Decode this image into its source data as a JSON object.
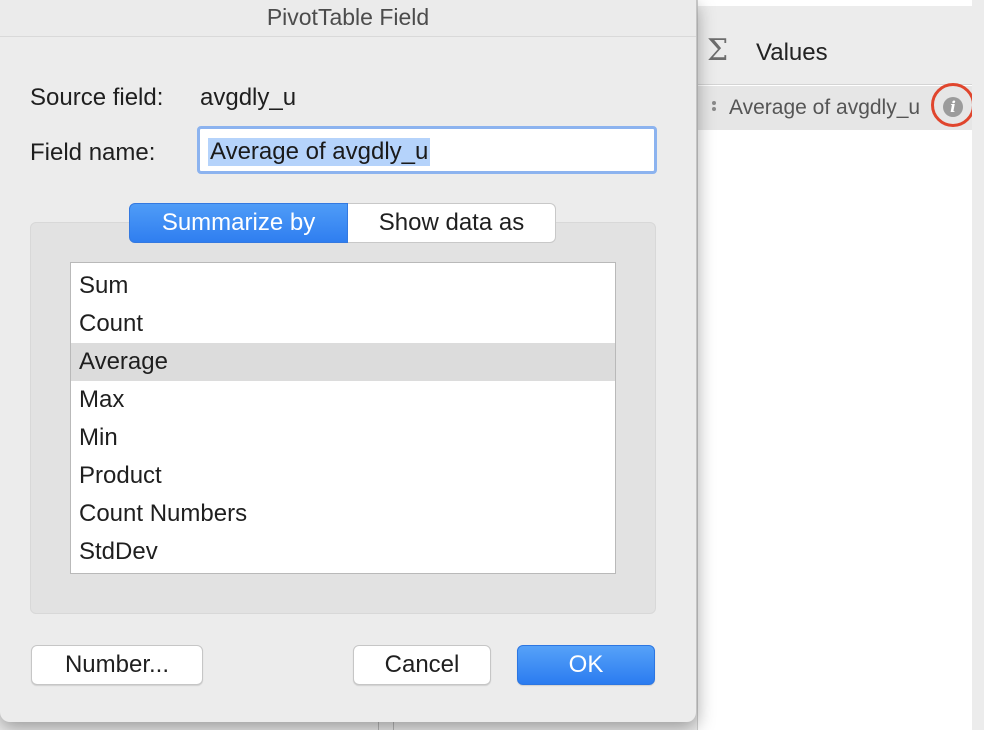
{
  "dialog": {
    "title": "PivotTable Field",
    "source_field_label": "Source field:",
    "source_field_value": "avgdly_u",
    "field_name_label": "Field name:",
    "field_name_value": "Average of avgdly_u",
    "tabs": [
      {
        "label": "Summarize by",
        "selected": true
      },
      {
        "label": "Show data as",
        "selected": false
      }
    ],
    "summarize_options": [
      {
        "label": "Sum"
      },
      {
        "label": "Count"
      },
      {
        "label": "Average",
        "selected": true
      },
      {
        "label": "Max"
      },
      {
        "label": "Min"
      },
      {
        "label": "Product"
      },
      {
        "label": "Count Numbers"
      },
      {
        "label": "StdDev"
      }
    ],
    "buttons": {
      "number": "Number...",
      "cancel": "Cancel",
      "ok": "OK"
    }
  },
  "field_list": {
    "values_header": "Values",
    "values_icon": "sigma-icon",
    "value_items": [
      {
        "label": "Average of avgdly_u"
      }
    ],
    "info_icon": "info-icon",
    "highlight_color": "#e0452d"
  },
  "colors": {
    "accent": "#2f7ef0",
    "selection_bg": "#b5d3fb",
    "list_selected_bg": "#dcdcdc"
  }
}
